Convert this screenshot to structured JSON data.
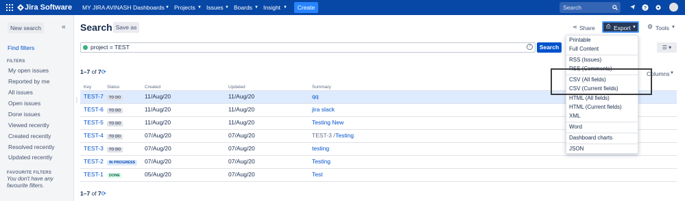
{
  "topbar": {
    "logo": "Jira Software",
    "project": "MY JIRA AVINASH",
    "nav": [
      "Dashboards",
      "Projects",
      "Issues",
      "Boards",
      "Insight"
    ],
    "create_label": "Create",
    "search_placeholder": "Search"
  },
  "sidebar": {
    "new_search": "New search",
    "find_filters": "Find filters",
    "filters_heading": "FILTERS",
    "filters": [
      "My open issues",
      "Reported by me",
      "All issues",
      "Open issues",
      "Done issues",
      "Viewed recently",
      "Created recently",
      "Resolved recently",
      "Updated recently"
    ],
    "favourite_heading": "FAVOURITE FILTERS",
    "favourite_empty": "You don't have any favourite filters."
  },
  "page": {
    "title": "Search",
    "save_as": "Save as",
    "share": "Share",
    "export": "Export",
    "tools": "Tools",
    "jql": "project = TEST",
    "search_button": "Search",
    "count_prefix": "1–7",
    "count_of": "of",
    "count_total": "7",
    "columns": "Columns"
  },
  "table": {
    "headers": {
      "key": "Key",
      "status": "Status",
      "created": "Created",
      "updated": "Updated",
      "summary": "Summary"
    },
    "rows": [
      {
        "key": "TEST-7",
        "status": "TO DO",
        "created": "11/Aug/20",
        "updated": "11/Aug/20",
        "parent": "",
        "summary": "qq"
      },
      {
        "key": "TEST-6",
        "status": "TO DO",
        "created": "11/Aug/20",
        "updated": "11/Aug/20",
        "parent": "",
        "summary": "jira slack"
      },
      {
        "key": "TEST-5",
        "status": "TO DO",
        "created": "11/Aug/20",
        "updated": "11/Aug/20",
        "parent": "",
        "summary": "Testing New"
      },
      {
        "key": "TEST-4",
        "status": "TO DO",
        "created": "07/Aug/20",
        "updated": "07/Aug/20",
        "parent": "TEST-3 /",
        "summary": "Testing"
      },
      {
        "key": "TEST-3",
        "status": "TO DO",
        "created": "07/Aug/20",
        "updated": "07/Aug/20",
        "parent": "",
        "summary": "testing"
      },
      {
        "key": "TEST-2",
        "status": "IN PROGRESS",
        "created": "07/Aug/20",
        "updated": "07/Aug/20",
        "parent": "",
        "summary": "Testing"
      },
      {
        "key": "TEST-1",
        "status": "DONE",
        "created": "05/Aug/20",
        "updated": "07/Aug/20",
        "parent": "",
        "summary": "Test"
      }
    ]
  },
  "export_menu": {
    "items": [
      "Printable",
      "Full Content",
      "RSS (Issues)",
      "RSS (Comments)",
      "CSV (All fields)",
      "CSV (Current fields)",
      "HTML (All fields)",
      "HTML (Current fields)",
      "XML",
      "Word",
      "Dashboard charts",
      "JSON"
    ]
  },
  "colors": {
    "topbar": "#0747a6",
    "create": "#2684ff",
    "link": "#0052cc",
    "selected_row": "#deebff"
  }
}
